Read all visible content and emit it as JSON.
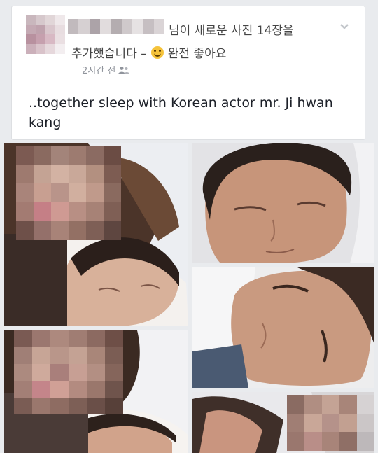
{
  "post": {
    "header_line1": "님이 새로운 사진 14장을",
    "header_line2_prefix": "추가했습니다 –",
    "header_line2_feeling": "완전 좋아요",
    "timestamp": "2시간 전",
    "caption": "..together sleep with Korean actor mr. Ji hwan kang"
  },
  "icons": {
    "feeling": "smile-icon",
    "audience": "friends-icon",
    "menu": "chevron-down-icon"
  },
  "photos": [
    {
      "id": "photo-1",
      "desc": "selfie-pixelated-woman-and-sleeping-man"
    },
    {
      "id": "photo-2",
      "desc": "sleeping-man-closeup"
    },
    {
      "id": "photo-3",
      "desc": "sleeping-man-closeup-2"
    },
    {
      "id": "photo-4",
      "desc": "selfie-pixelated-woman-and-sleeping-man-2"
    },
    {
      "id": "photo-5",
      "desc": "pixelated-woman-and-man"
    }
  ]
}
